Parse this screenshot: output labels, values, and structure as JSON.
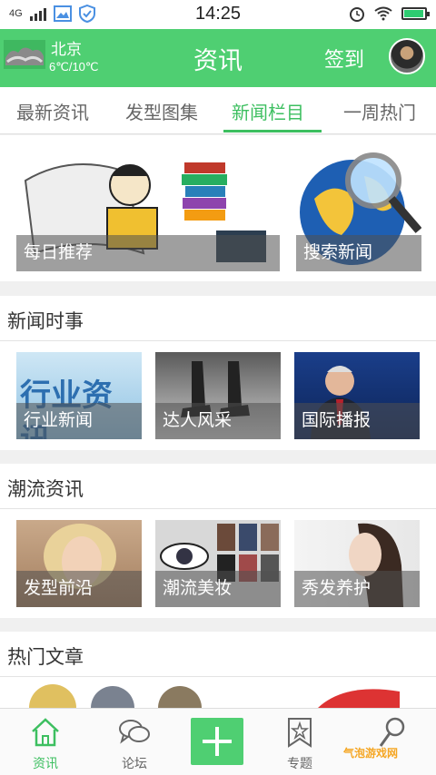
{
  "status_bar": {
    "network": "4G",
    "time": "14:25"
  },
  "header": {
    "city": "北京",
    "temperature": "6℃/10℃",
    "title": "资讯",
    "checkin": "签到"
  },
  "tabs": [
    {
      "label": "最新资讯",
      "active": false
    },
    {
      "label": "发型图集",
      "active": false
    },
    {
      "label": "新闻栏目",
      "active": true
    },
    {
      "label": "一周热门",
      "active": false
    }
  ],
  "featured": [
    {
      "caption": "每日推荐",
      "image": "cartoon-reading-illustration"
    },
    {
      "caption": "搜索新闻",
      "image": "globe-magnifier"
    }
  ],
  "sections": [
    {
      "title": "新闻时事",
      "items": [
        {
          "caption": "行业新闻",
          "image_text": "行业资讯"
        },
        {
          "caption": "达人风采"
        },
        {
          "caption": "国际播报"
        }
      ]
    },
    {
      "title": "潮流资讯",
      "items": [
        {
          "caption": "发型前沿"
        },
        {
          "caption": "潮流美妆"
        },
        {
          "caption": "秀发养护"
        }
      ]
    },
    {
      "title": "热门文章",
      "items": []
    }
  ],
  "bottom_nav": [
    {
      "label": "资讯",
      "icon": "home-icon",
      "active": true
    },
    {
      "label": "论坛",
      "icon": "chat-bubbles-icon",
      "active": false
    },
    {
      "label": "",
      "icon": "add-icon",
      "active": false
    },
    {
      "label": "专题",
      "icon": "star-bookmark-icon",
      "active": false
    },
    {
      "label": "",
      "icon": "search-icon",
      "active": false
    }
  ],
  "watermark": "气泡游戏网",
  "colors": {
    "brand_green": "#4fcf72",
    "active_tab": "#3dbf60"
  }
}
